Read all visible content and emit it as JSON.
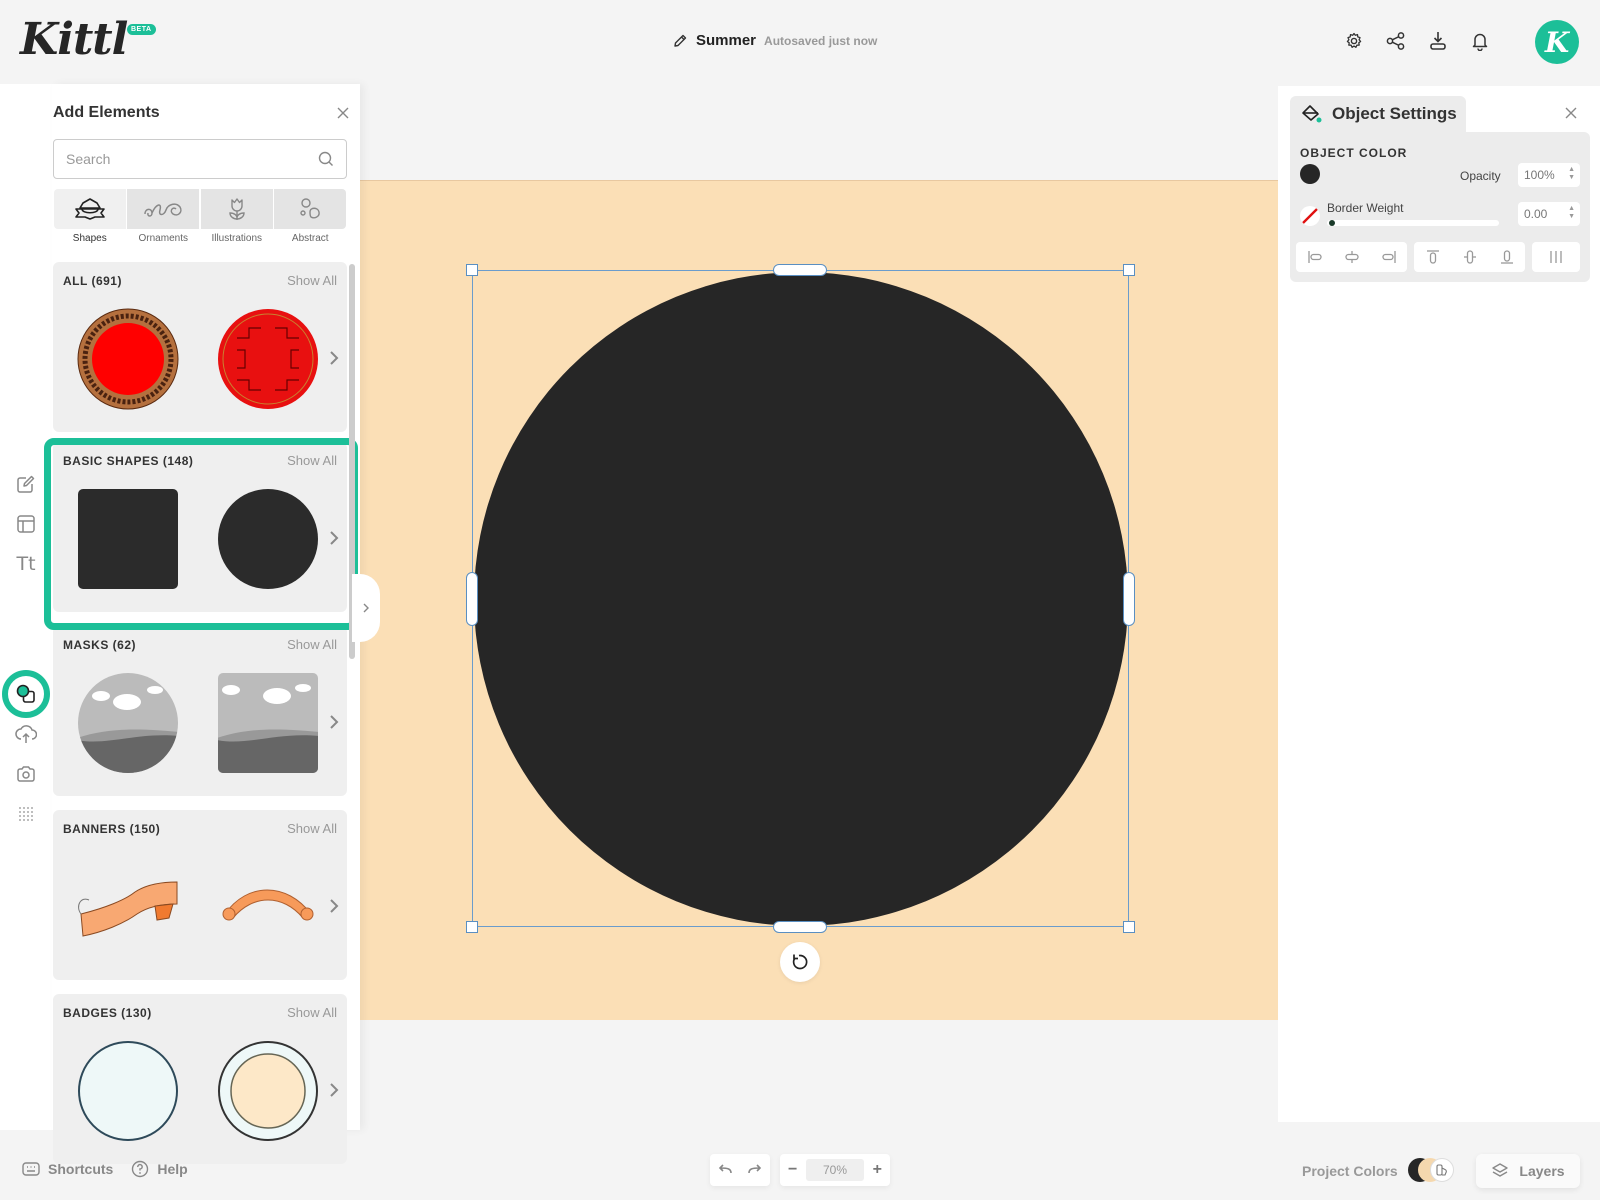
{
  "app": {
    "logo": "Kittl",
    "beta_badge": "BETA"
  },
  "header": {
    "doc_name": "Summer",
    "save_status": "Autosaved just now",
    "icons": [
      "settings-icon",
      "share-icon",
      "download-icon",
      "bell-icon"
    ],
    "avatar_initial": "K"
  },
  "rail": {
    "items": [
      "edit-icon",
      "templates-icon",
      "text-icon",
      "elements-icon",
      "upload-icon",
      "camera-icon",
      "dots-grid-icon"
    ],
    "active": "elements-icon"
  },
  "panel": {
    "title": "Add Elements",
    "search_placeholder": "Search",
    "categories": [
      {
        "label": "Shapes",
        "active": true
      },
      {
        "label": "Ornaments",
        "active": false
      },
      {
        "label": "Illustrations",
        "active": false
      },
      {
        "label": "Abstract",
        "active": false
      }
    ],
    "show_all_label": "Show All",
    "sections": [
      {
        "title": "ALL (691)"
      },
      {
        "title": "BASIC SHAPES (148)",
        "highlighted": true
      },
      {
        "title": "MASKS (62)"
      },
      {
        "title": "BANNERS (150)"
      },
      {
        "title": "BADGES (130)"
      }
    ]
  },
  "canvas": {
    "background_color": "#fbdfb6",
    "object": {
      "type": "circle",
      "color": "#262626"
    }
  },
  "object_settings": {
    "title": "Object Settings",
    "object_color_label": "OBJECT COLOR",
    "object_color": "#262626",
    "opacity_label": "Opacity",
    "opacity_value": "100%",
    "border_weight_label": "Border Weight",
    "border_weight_value": "0.00",
    "border_weight_fraction": 0,
    "align_buttons": [
      "align-left",
      "align-center-horizontal",
      "align-right",
      "align-top",
      "align-center-vertical",
      "align-bottom",
      "distribute"
    ]
  },
  "bottom": {
    "shortcuts_label": "Shortcuts",
    "help_label": "Help",
    "zoom_value": "70%",
    "project_colors_label": "Project Colors",
    "project_colors": [
      "#262626",
      "#fbdfb6"
    ],
    "layers_label": "Layers"
  },
  "theme": {
    "accent": "#1cbf98"
  }
}
